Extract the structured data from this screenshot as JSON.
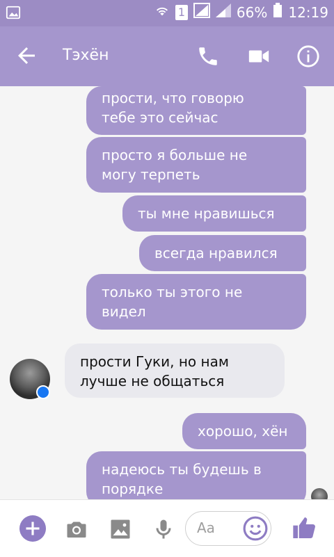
{
  "status": {
    "battery": "66%",
    "time": "12:19",
    "sim": "1"
  },
  "header": {
    "title": "Тэхён"
  },
  "messages": [
    {
      "from": "me",
      "lines": [
        "прости, что говорю",
        "тебе это сейчас"
      ]
    },
    {
      "from": "me",
      "lines": [
        "просто я больше не",
        "могу терпеть"
      ]
    },
    {
      "from": "me",
      "lines": [
        "ты мне нравишься"
      ]
    },
    {
      "from": "me",
      "lines": [
        "всегда нравился"
      ]
    },
    {
      "from": "me",
      "lines": [
        "только ты этого не",
        "видел"
      ]
    },
    {
      "from": "them",
      "lines": [
        "прости Гуки, но нам",
        "лучше не общаться"
      ]
    },
    {
      "from": "me",
      "lines": [
        "хорошо, хён"
      ]
    },
    {
      "from": "me",
      "lines": [
        "надеюсь ты будешь в",
        "порядке"
      ]
    }
  ],
  "composer": {
    "placeholder": "Aa"
  },
  "colors": {
    "bar": "#a596cd",
    "statusbar": "#9c8cc4",
    "bubble_out": "#a596cd",
    "bubble_in": "#e9e9ee",
    "accent": "#8e7cc3"
  }
}
